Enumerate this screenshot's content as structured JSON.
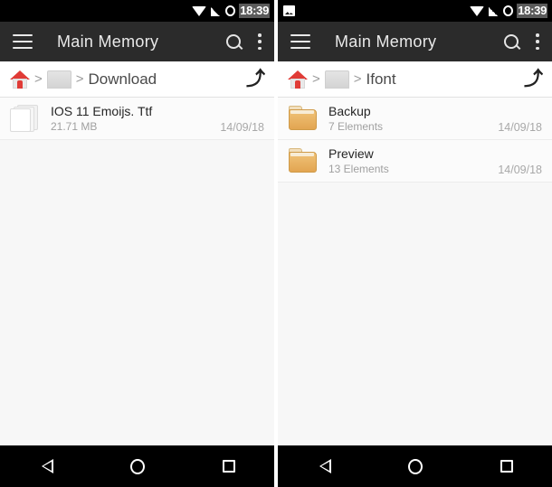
{
  "panels": [
    {
      "statusbar": {
        "notification_icon": "image-notification-icon",
        "show_notification": false,
        "wifi_icon": "wifi-icon",
        "signal_icon": "cellular-signal-icon",
        "battery_icon": "battery-icon",
        "time": "18:39"
      },
      "appbar": {
        "menu_icon": "hamburger-menu-icon",
        "title": "Main Memory",
        "search_icon": "search-icon",
        "overflow_icon": "overflow-menu-icon"
      },
      "breadcrumb": {
        "home_icon": "home-icon",
        "separator": ">",
        "storage_icon": "internal-storage-icon",
        "separator2": ">",
        "path": "Download",
        "up_icon": "go-up-icon",
        "up_glyph": "⤴"
      },
      "rows": [
        {
          "icon": "file-icon",
          "type": "file",
          "name": "IOS 11 Emoijs. Ttf",
          "meta": "21.71 MB",
          "date": "14/09/18"
        }
      ]
    },
    {
      "statusbar": {
        "notification_icon": "image-notification-icon",
        "show_notification": true,
        "wifi_icon": "wifi-icon",
        "signal_icon": "cellular-signal-icon",
        "battery_icon": "battery-icon",
        "time": "18:39"
      },
      "appbar": {
        "menu_icon": "hamburger-menu-icon",
        "title": "Main Memory",
        "search_icon": "search-icon",
        "overflow_icon": "overflow-menu-icon"
      },
      "breadcrumb": {
        "home_icon": "home-icon",
        "separator": ">",
        "storage_icon": "internal-storage-icon",
        "separator2": ">",
        "path": "Ifont",
        "up_icon": "go-up-icon",
        "up_glyph": "⤴"
      },
      "rows": [
        {
          "icon": "folder-icon",
          "type": "folder",
          "name": "Backup",
          "meta": "7 Elements",
          "date": "14/09/18"
        },
        {
          "icon": "folder-icon",
          "type": "folder",
          "name": "Preview",
          "meta": "13 Elements",
          "date": "14/09/18"
        }
      ]
    }
  ],
  "navbar": {
    "back_label": "Back",
    "home_label": "Home",
    "recents_label": "Recents",
    "back_icon": "back-triangle-icon",
    "home_icon": "home-circle-icon",
    "recents_icon": "recents-square-icon"
  },
  "colors": {
    "appbar_bg": "#2b2b2b",
    "statusbar_bg": "#000000",
    "content_bg": "#f7f7f7",
    "row_bg": "#fbfbfb",
    "folder_accent": "#e2a551",
    "home_accent": "#e03b36",
    "navbar_bg": "#000000"
  }
}
